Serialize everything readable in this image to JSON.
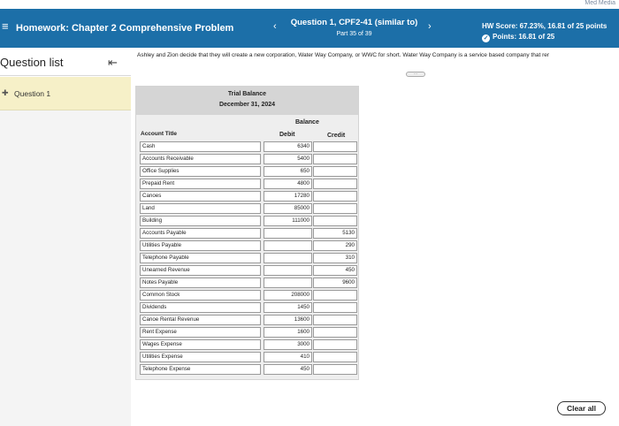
{
  "topstrip": {
    "corner_text": "Med Media"
  },
  "header": {
    "menu_icon": "hamburger-menu-icon",
    "title": "Homework: Chapter 2 Comprehensive Problem",
    "question_title": "Question 1, CPF2-41 (similar to)",
    "question_sub": "Part 35 of 39",
    "hw_score": "HW Score: 67.23%, 16.81 of 25 points",
    "points": "Points: 16.81 of 25",
    "prev_icon": "chevron-left-icon",
    "next_icon": "chevron-right-icon"
  },
  "sidebar": {
    "title": "Question list",
    "collapse_icon": "collapse-left-icon",
    "items": [
      {
        "label": "Question 1",
        "icon": "partial-credit-icon"
      }
    ]
  },
  "problem": {
    "text": "Ashley and Zion decide that they will create a new corporation, Water Way Company, or WWC for short. Water Way Company is a service based company that rer"
  },
  "trial_balance": {
    "title": "Trial Balance",
    "date": "December 31, 2024",
    "balance_label": "Balance",
    "col_account": "Account Title",
    "col_debit": "Debit",
    "col_credit": "Credit",
    "rows": [
      {
        "account": "Cash",
        "debit": "6340",
        "credit": ""
      },
      {
        "account": "Accounts Receivable",
        "debit": "5400",
        "credit": ""
      },
      {
        "account": "Office Supplies",
        "debit": "650",
        "credit": ""
      },
      {
        "account": "Prepaid Rent",
        "debit": "4800",
        "credit": ""
      },
      {
        "account": "Canoes",
        "debit": "17280",
        "credit": ""
      },
      {
        "account": "Land",
        "debit": "85000",
        "credit": ""
      },
      {
        "account": "Building",
        "debit": "111000",
        "credit": ""
      },
      {
        "account": "Accounts Payable",
        "debit": "",
        "credit": "5130"
      },
      {
        "account": "Utilities Payable",
        "debit": "",
        "credit": "290"
      },
      {
        "account": "Telephone Payable",
        "debit": "",
        "credit": "310"
      },
      {
        "account": "Unearned Revenue",
        "debit": "",
        "credit": "450"
      },
      {
        "account": "Notes Payable",
        "debit": "",
        "credit": "9600"
      },
      {
        "account": "Common Stock",
        "debit": "208000",
        "credit": ""
      },
      {
        "account": "Dividends",
        "debit": "1450",
        "credit": ""
      },
      {
        "account": "Canoe Rental Revenue",
        "debit": "13600",
        "credit": ""
      },
      {
        "account": "Rent Expense",
        "debit": "1600",
        "credit": ""
      },
      {
        "account": "Wages Expense",
        "debit": "3000",
        "credit": ""
      },
      {
        "account": "Utilities Expense",
        "debit": "410",
        "credit": ""
      },
      {
        "account": "Telephone Expense",
        "debit": "450",
        "credit": ""
      }
    ]
  },
  "actions": {
    "clear_all": "Clear all"
  }
}
